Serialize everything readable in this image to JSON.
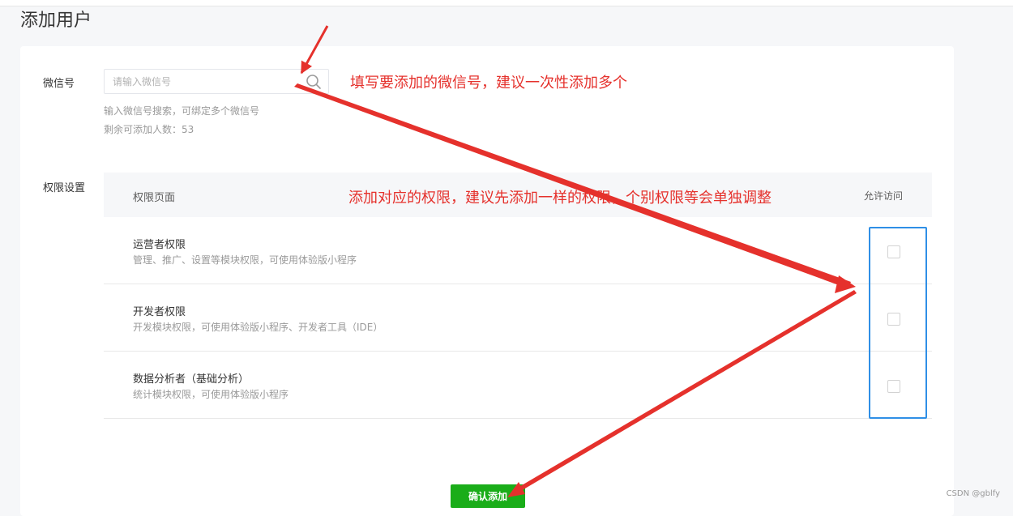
{
  "page": {
    "title": "添加用户"
  },
  "wechat_field": {
    "label": "微信号",
    "placeholder": "请输入微信号",
    "value": "",
    "hint": "输入微信号搜索，可绑定多个微信号",
    "remaining": "剩余可添加人数：53"
  },
  "permissions": {
    "label": "权限设置",
    "header_page": "权限页面",
    "header_allow": "允许访问",
    "rows": [
      {
        "title": "运营者权限",
        "desc": "管理、推广、设置等模块权限，可使用体验版小程序"
      },
      {
        "title": "开发者权限",
        "desc": "开发模块权限，可使用体验版小程序、开发者工具（IDE）"
      },
      {
        "title": "数据分析者（基础分析）",
        "desc": "统计模块权限，可使用体验版小程序"
      }
    ]
  },
  "confirm_label": "确认添加",
  "annotations": {
    "wechat_tip": "填写要添加的微信号，建议一次性添加多个",
    "perm_tip": "添加对应的权限，建议先添加一样的权限，个别权限等会单独调整"
  },
  "watermark": "CSDN @gblfy",
  "colors": {
    "accent_green": "#1aad19",
    "annotation_red": "#e5312c",
    "highlight_blue": "#2f8fe6"
  }
}
